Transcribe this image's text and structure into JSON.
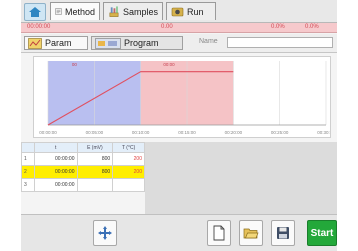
{
  "tabs": [
    {
      "label": "Method",
      "icon": "method-icon"
    },
    {
      "label": "Samples",
      "icon": "samples-icon"
    },
    {
      "label": "Run",
      "icon": "run-icon"
    }
  ],
  "status": {
    "left": "00:00:00",
    "center": "0.00",
    "right1": "0.0%",
    "right2": "0.0%"
  },
  "toolbar": {
    "param_label": "Param",
    "program_label": "Program",
    "name_label": "Name"
  },
  "chart_data": {
    "type": "line",
    "x_labels": [
      "00:00:00",
      "00:05:00",
      "00:10:00",
      "00:15:00",
      "00:20:00",
      "00:25:00",
      "00:30:00"
    ],
    "series": [
      {
        "values": [
          [
            0,
            0
          ],
          [
            10,
            100
          ],
          [
            20,
            100
          ]
        ]
      }
    ],
    "segments": [
      {
        "from": 0,
        "to": 10,
        "color": "#b9bff0"
      },
      {
        "from": 10,
        "to": 20,
        "color": "#f5c3c6"
      }
    ],
    "xlim": [
      0,
      30
    ],
    "ylim": [
      0,
      120
    ],
    "segment_labels": [
      "00",
      "00:00"
    ],
    "line_color": "#e05060",
    "grid": true
  },
  "table": {
    "headers": [
      "",
      "t",
      "E (mV)",
      "T (°C)"
    ],
    "rows": [
      [
        "1",
        "00:00:00",
        "800",
        "200"
      ],
      [
        "2",
        "00:00:00",
        "800",
        "200"
      ],
      [
        "3",
        "00:00:00",
        "",
        ""
      ]
    ]
  },
  "bottom": {
    "start_label": "Start"
  },
  "colors": {
    "start": "#23a83a",
    "highlight_row": "#ffee00",
    "status_bar": "#f6c9cc"
  }
}
